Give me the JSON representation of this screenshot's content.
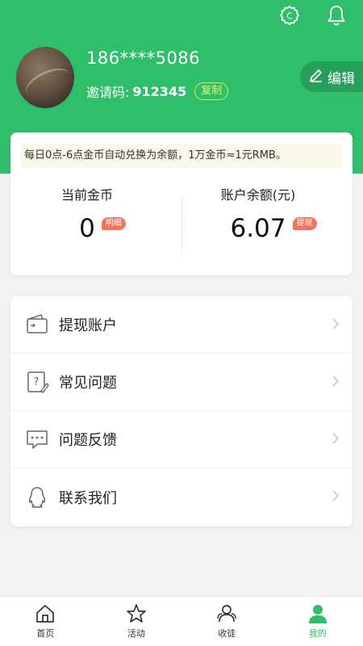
{
  "header": {
    "phone": "186****5086",
    "invite_label": "邀请码:",
    "invite_code": "912345",
    "copy_label": "复制",
    "edit_label": "编辑",
    "icons": [
      "settings-icon",
      "bell-icon"
    ]
  },
  "coins_card": {
    "notice": "每日0点-6点金币自动兑换为余额，1万金币≈1元RMB。",
    "coins_label": "当前金币",
    "coins_value": "0",
    "coins_tag": "明细",
    "balance_label": "账户余额(元)",
    "balance_value": "6.07",
    "balance_tag": "提现"
  },
  "menu": {
    "items": [
      {
        "label": "提现账户",
        "icon": "wallet-icon"
      },
      {
        "label": "常见问题",
        "icon": "question-icon"
      },
      {
        "label": "问题反馈",
        "icon": "chat-icon"
      },
      {
        "label": "联系我们",
        "icon": "qq-icon"
      }
    ]
  },
  "tabbar": {
    "tabs": [
      {
        "label": "首页",
        "icon": "home-icon"
      },
      {
        "label": "活动",
        "icon": "star-icon"
      },
      {
        "label": "收徒",
        "icon": "users-icon"
      },
      {
        "label": "我的",
        "icon": "user-icon",
        "active": true
      }
    ]
  },
  "colors": {
    "brand": "#2fbf6b",
    "tag": "#f4725a",
    "copy_border": "#d7e56a"
  }
}
